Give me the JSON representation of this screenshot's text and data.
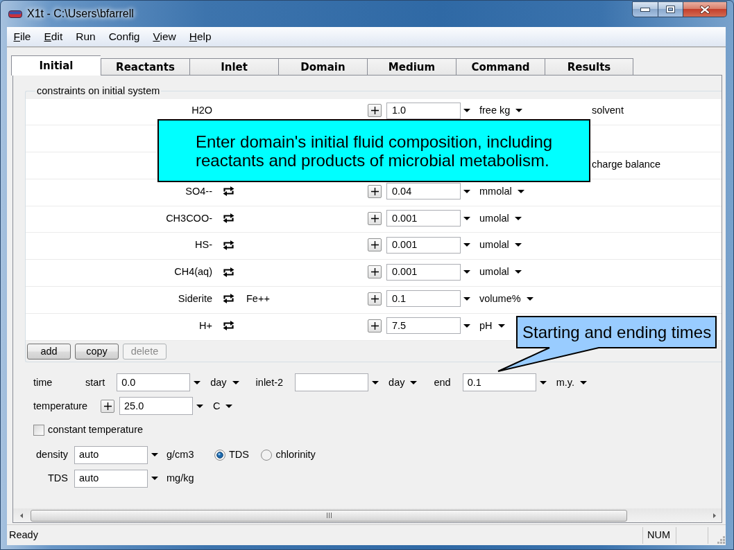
{
  "window": {
    "title": "X1t - C:\\Users\\bfarrell"
  },
  "menu": [
    {
      "label": "File",
      "mnemonic": true
    },
    {
      "label": "Edit",
      "mnemonic": true
    },
    {
      "label": "Run",
      "mnemonic": false
    },
    {
      "label": "Config",
      "mnemonic": false
    },
    {
      "label": "View",
      "mnemonic": true
    },
    {
      "label": "Help",
      "mnemonic": true
    }
  ],
  "tabs": [
    {
      "label": "Initial",
      "selected": true
    },
    {
      "label": "Reactants",
      "selected": false
    },
    {
      "label": "Inlet",
      "selected": false
    },
    {
      "label": "Domain",
      "selected": false
    },
    {
      "label": "Medium",
      "selected": false
    },
    {
      "label": "Command",
      "selected": false
    },
    {
      "label": "Results",
      "selected": false
    }
  ],
  "constraints": {
    "title": "constraints on initial system",
    "rows": [
      {
        "kind": "species",
        "species": "H2O",
        "swap": false,
        "value": "1.0",
        "unit": "free kg",
        "note": "solvent"
      },
      {
        "kind": "covered"
      },
      {
        "kind": "covered",
        "note": "charge balance"
      },
      {
        "kind": "species",
        "species": "SO4--",
        "swap": true,
        "value": "0.04",
        "unit": "mmolal"
      },
      {
        "kind": "species",
        "species": "CH3COO-",
        "swap": true,
        "value": "0.001",
        "unit": "umolal"
      },
      {
        "kind": "species",
        "species": "HS-",
        "swap": true,
        "value": "0.001",
        "unit": "umolal"
      },
      {
        "kind": "species",
        "species": "CH4(aq)",
        "swap": true,
        "value": "0.001",
        "unit": "umolal"
      },
      {
        "kind": "species",
        "species": "Siderite",
        "swap": true,
        "swap_with": "Fe++",
        "value": "0.1",
        "unit": "volume%"
      },
      {
        "kind": "species",
        "species": "H+",
        "swap": true,
        "value": "7.5",
        "unit": "pH"
      }
    ],
    "buttons": [
      {
        "label": "add",
        "disabled": false
      },
      {
        "label": "copy",
        "disabled": false
      },
      {
        "label": "delete",
        "disabled": true
      }
    ]
  },
  "settings": {
    "time": {
      "label": "time",
      "fields": [
        {
          "label": "start",
          "value": "0.0",
          "unit": "day"
        },
        {
          "label": "inlet-2",
          "unit": "day"
        },
        {
          "label": "end",
          "value": "0.1",
          "unit": "m.y."
        }
      ]
    },
    "temperature": {
      "label": "temperature",
      "value": "25.0",
      "unit": "C"
    },
    "constant_temperature": {
      "label": "constant temperature",
      "checked": false
    },
    "density": {
      "label": "density",
      "value": "auto",
      "unit": "g/cm3"
    },
    "basis": [
      {
        "label": "TDS",
        "selected": true
      },
      {
        "label": "chlorinity",
        "selected": false
      }
    ],
    "tds": {
      "label": "TDS",
      "value": "auto",
      "unit": "mg/kg"
    }
  },
  "status_bar": {
    "text": "Ready",
    "indicators": [
      "NUM"
    ]
  },
  "callouts": [
    {
      "text": "Enter domain's initial fluid composition, including reactants and products of microbial metabolism.",
      "color": "#00ffff",
      "pointer": false
    },
    {
      "text": "Starting and ending times",
      "color": "#99ccff",
      "pointer": true
    }
  ]
}
